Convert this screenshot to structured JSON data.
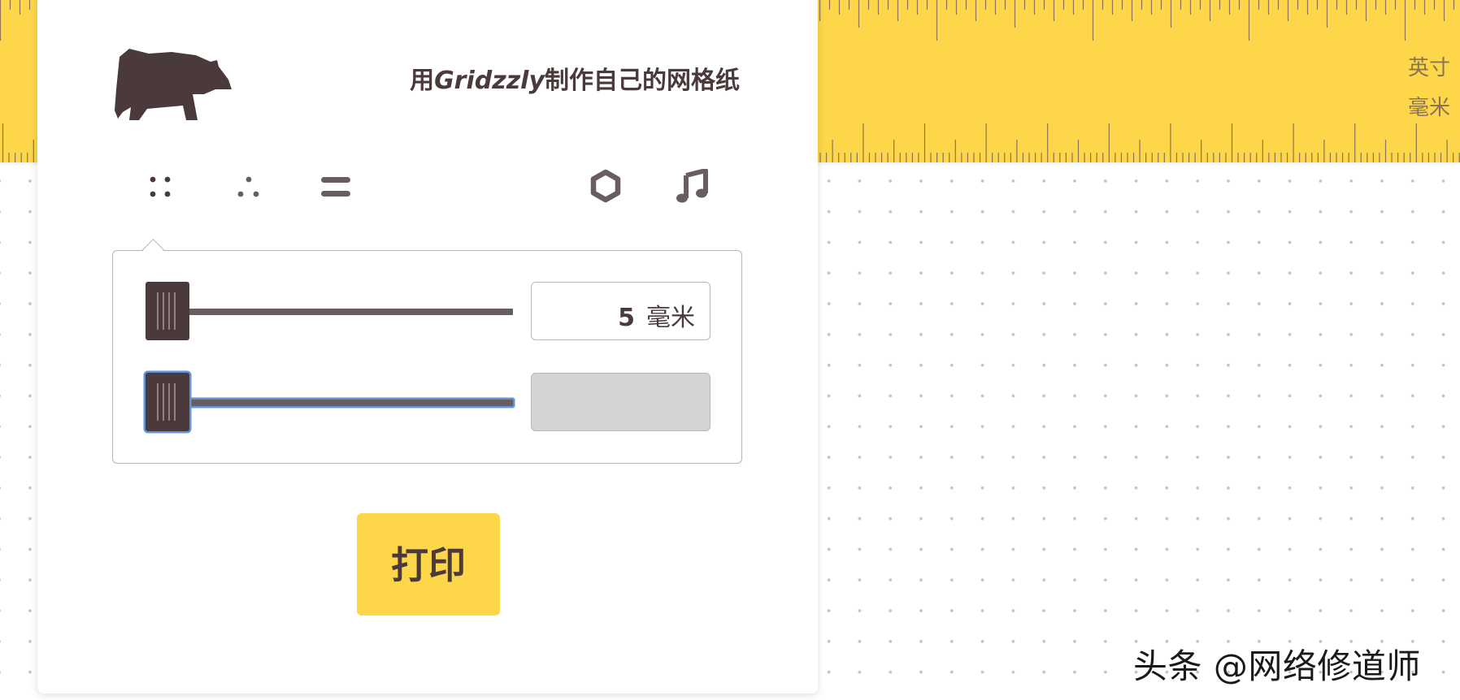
{
  "ruler": {
    "unit_inch_label": "英寸",
    "unit_mm_label": "毫米",
    "background_color": "#fdd64a",
    "tick_color": "#8a7452"
  },
  "header": {
    "logo_icon": "bear-icon",
    "tagline_prefix": "用",
    "tagline_brand": "Gridzzly",
    "tagline_suffix": "制作自己的网格纸"
  },
  "toolbar": {
    "tools": [
      {
        "name": "dot-grid",
        "icon": "dot-grid-icon",
        "selected": true
      },
      {
        "name": "triangle-dot-grid",
        "icon": "triangle-dots-icon"
      },
      {
        "name": "line-grid",
        "icon": "lines-icon"
      },
      {
        "name": "hexagon-grid",
        "icon": "hexagon-icon"
      },
      {
        "name": "music-staff",
        "icon": "music-note-icon"
      }
    ]
  },
  "settings": {
    "spacing": {
      "value": "5",
      "unit": "毫米",
      "slider_level": 0
    },
    "dot_size": {
      "value": "",
      "slider_level": 0,
      "focused": true
    }
  },
  "print_button": {
    "label": "打印"
  },
  "watermark": {
    "text": "头条 @网络修道师"
  },
  "colors": {
    "accent_yellow": "#fdd64a",
    "text_dark": "#4a3a3b",
    "focus_blue": "#5d95d8"
  }
}
